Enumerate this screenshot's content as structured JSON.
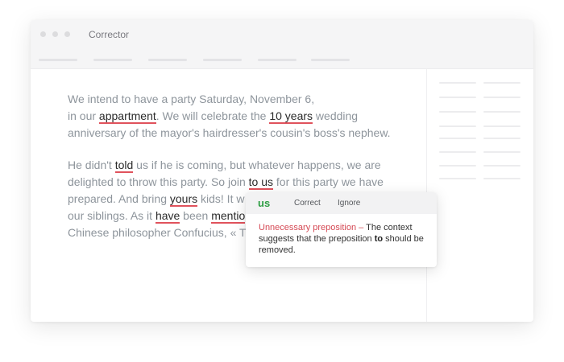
{
  "window": {
    "title": "Corrector"
  },
  "editor": {
    "p1": {
      "l1": "We intend to have a party Saturday, November 6,",
      "l2_a": "in our ",
      "l2_err1": "appartment",
      "l2_b": ".  We will celebrate the ",
      "l2_err2": "10 years",
      "l2_c": " wedding",
      "l3": "anniversary of the mayor's hairdresser's cousin's boss's nephew."
    },
    "p2": {
      "l1_a": "He didn't ",
      "l1_err": "told",
      "l1_b": " us if he is coming, but whatever happens, we are",
      "l2_a": "delighted to throw this party. So join ",
      "l2_err": "to us",
      "l2_b": " for this party we have",
      "l3_a": "prepared. And bring ",
      "l3_err": "yours",
      "l3_b": " kids! It w",
      "l4_a": "our siblings. As it ",
      "l4_err1": "have",
      "l4_b": " been ",
      "l4_err2": "mentio",
      "l5": "Chinese philosopher Confucius, « T"
    }
  },
  "popup": {
    "suggestion": "us",
    "correct_label": "Correct",
    "ignore_label": "Ignore",
    "error_type": "Unnecessary preposition –",
    "explain_a": " The context suggests that the preposition ",
    "explain_word": "to",
    "explain_b": " should be removed."
  },
  "colors": {
    "error_underline": "#e0525c",
    "suggestion": "#2e9e44",
    "error_label": "#d54a55"
  }
}
